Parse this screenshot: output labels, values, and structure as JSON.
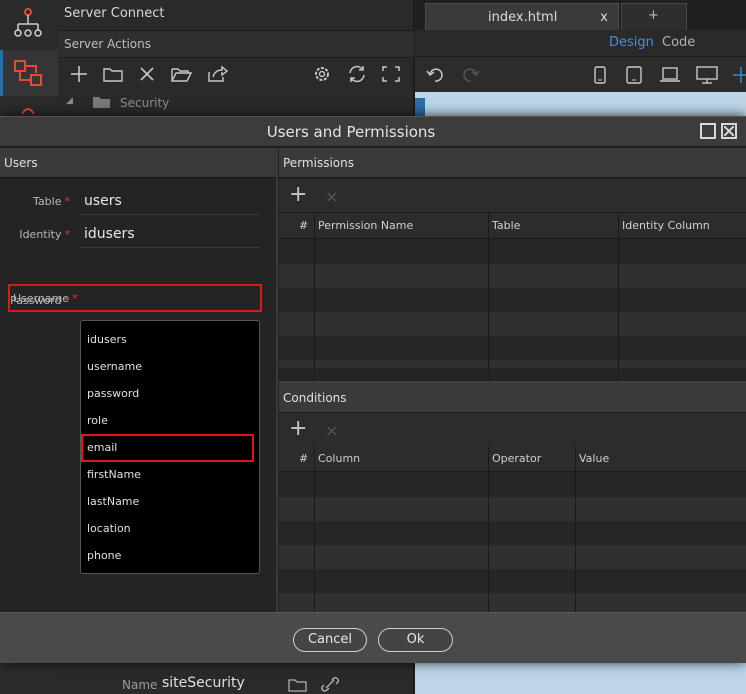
{
  "ide": {
    "left_title": "Server Connect",
    "actions_title": "Server Actions",
    "tree_folder": "Security",
    "tabs": [
      {
        "label": "index.html",
        "close": "x"
      },
      {
        "label": "+"
      }
    ],
    "view_design": "Design",
    "view_code": "Code",
    "prop_name_label": "Name",
    "prop_name_value": "siteSecurity",
    "accent": "#2a6ea6"
  },
  "dialog": {
    "title": "Users and Permissions",
    "users": {
      "header": "Users",
      "fields": [
        {
          "label": "Table",
          "value": "users"
        },
        {
          "label": "Identity",
          "value": "idusers"
        },
        {
          "label": "Username",
          "value": ""
        },
        {
          "label": "Password",
          "value": ""
        }
      ],
      "required_mark": "*",
      "dropdown_options": [
        "idusers",
        "username",
        "password",
        "role",
        "email",
        "firstName",
        "lastName",
        "location",
        "phone"
      ],
      "highlighted_option": "email",
      "highlight_color": "#e01616"
    },
    "permissions": {
      "header": "Permissions",
      "add": "+",
      "remove": "×",
      "columns": [
        "#",
        "Permission Name",
        "Table",
        "Identity Column"
      ]
    },
    "conditions": {
      "header": "Conditions",
      "add": "+",
      "remove": "×",
      "columns": [
        "#",
        "Column",
        "Operator",
        "Value"
      ]
    },
    "buttons": {
      "cancel": "Cancel",
      "ok": "Ok"
    }
  }
}
